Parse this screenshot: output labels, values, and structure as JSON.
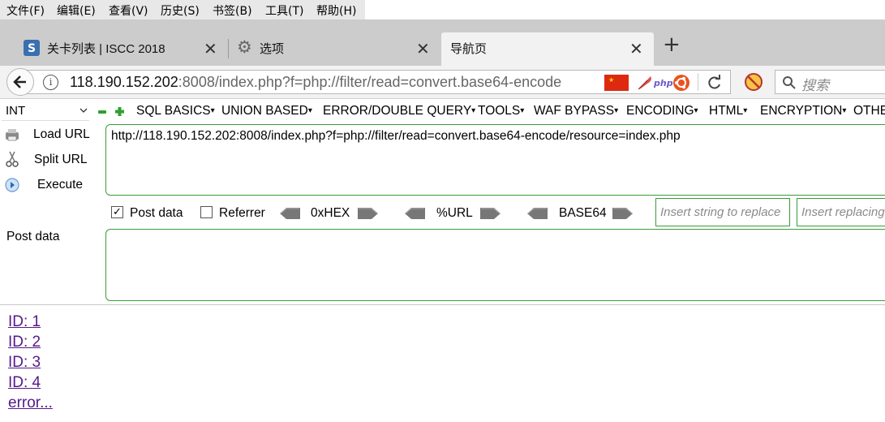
{
  "menubar": {
    "items": [
      "文件(F)",
      "编辑(E)",
      "查看(V)",
      "历史(S)",
      "书签(B)",
      "工具(T)",
      "帮助(H)"
    ]
  },
  "tabs": [
    {
      "label": "关卡列表 | ISCC 2018",
      "icon": "site-favicon-icon",
      "active": false
    },
    {
      "label": "选项",
      "icon": "gear-icon",
      "active": false
    },
    {
      "label": "导航页",
      "icon": "",
      "active": true
    }
  ],
  "navbar": {
    "url_host": "118.190.152.202",
    "url_rest": ":8008/index.php?f=php://filter/read=convert.base64-encode",
    "search_placeholder": "搜索"
  },
  "hackbar": {
    "select_value": "INT",
    "menus": [
      "SQL BASICS",
      "UNION BASED",
      "ERROR/DOUBLE QUERY",
      "TOOLS",
      "WAF BYPASS",
      "ENCODING",
      "HTML",
      "ENCRYPTION",
      "OTHE"
    ],
    "load_url": "Load URL",
    "split_url": "Split URL",
    "execute": "Execute",
    "url_value": "http://118.190.152.202:8008/index.php?f=php://filter/read=convert.base64-encode/resource=index.php",
    "post_data_checkbox": "Post data",
    "post_data_checked": true,
    "referrer_checkbox": "Referrer",
    "referrer_checked": false,
    "hex": "0xHEX",
    "urlenc": "%URL",
    "base64": "BASE64",
    "replace_placeholder": "Insert string to replace",
    "replacing_placeholder": "Insert replacing string",
    "post_data_label": "Post data"
  },
  "page": {
    "links": [
      "ID: 1",
      "ID: 2",
      "ID: 3",
      "ID: 4",
      "error..."
    ]
  },
  "colors": {
    "accent_green": "#3a9c3a",
    "visited_link": "#551a8b"
  }
}
